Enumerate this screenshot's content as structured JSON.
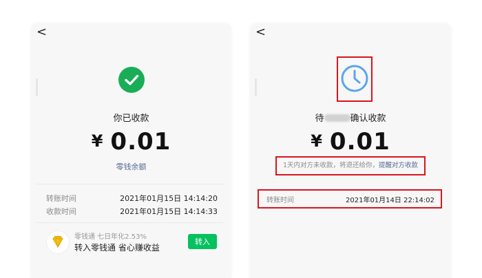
{
  "left_panel": {
    "back_glyph": "<",
    "status_title": "你已收款",
    "currency": "¥",
    "amount": "0.01",
    "balance_link": "零钱余额",
    "details": [
      {
        "label": "转账时间",
        "value": "2021年01月15日 14:14:20"
      },
      {
        "label": "收款时间",
        "value": "2021年01月15日 14:14:33"
      }
    ],
    "promo": {
      "subtitle": "零钱通 七日年化2.53%",
      "title": "转入零钱通 省心赚收益",
      "button_label": "转入"
    }
  },
  "right_panel": {
    "back_glyph": "<",
    "status_prefix": "待",
    "status_suffix": "确认收款",
    "currency": "¥",
    "amount": "0.01",
    "note_text": "1天内对方未收款，将退还给你，",
    "note_link": "提醒对方收款",
    "details": [
      {
        "label": "转账时间",
        "value": "2021年01月14日 22:14:02"
      }
    ]
  },
  "colors": {
    "success_green": "#1aad57",
    "button_green": "#07c160",
    "link_blue": "#576b95",
    "clock_blue": "#5aa5ee",
    "highlight_red": "#d9141c"
  },
  "icons": {
    "success": "checkmark-circle-icon",
    "pending": "clock-icon",
    "promo": "diamond-icon"
  }
}
